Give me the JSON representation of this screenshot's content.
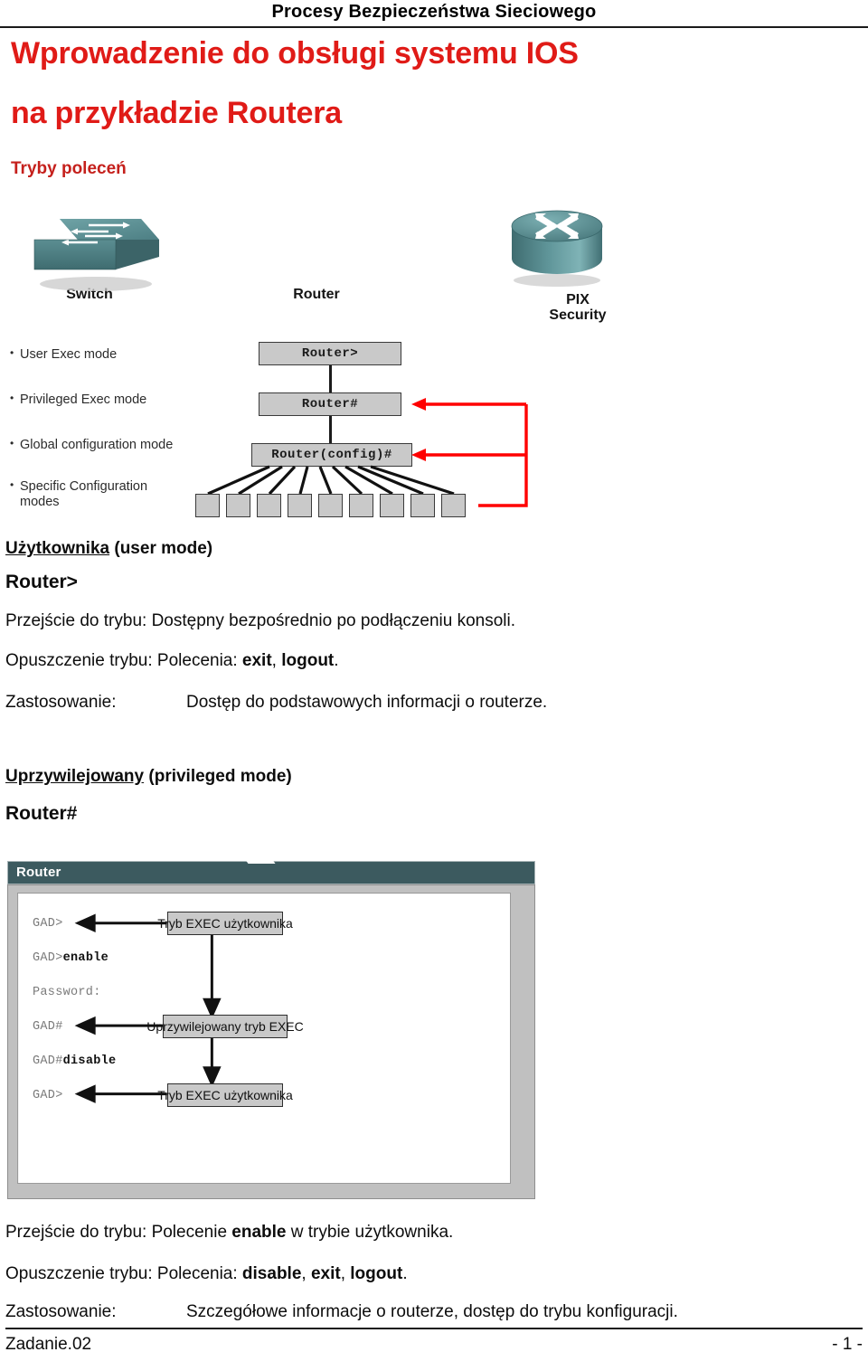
{
  "page": {
    "running_header": "Procesy Bezpieczeństwa Sieciowego",
    "title_line1": "Wprowadzenie do obsługi systemu IOS",
    "title_line2": "na przykładzie Routera",
    "subtitle": "Tryby poleceń",
    "title_color": "#e01b17",
    "subtitle_color": "#c5201c"
  },
  "figure_devices": {
    "switch": {
      "icon": "switch-icon",
      "caption": "Switch",
      "color": "#4f8489"
    },
    "router": {
      "icon": "router-icon",
      "caption": "Router",
      "color": "#4f8489"
    },
    "pix": {
      "icon": "firewall-icon",
      "caption_line1": "PIX",
      "caption_line2": "Security",
      "color": "#8e2f2f"
    }
  },
  "figure_hierarchy": {
    "bullets": [
      "User Exec mode",
      "Privileged Exec mode",
      "Global configuration mode",
      "Specific Configuration\nmodes"
    ],
    "bullet_1": "User Exec mode",
    "bullet_2": "Privileged Exec mode",
    "bullet_3": "Global configuration mode",
    "bullet_4a": "Specific Configuration",
    "bullet_4b": "modes",
    "nodes": [
      {
        "label": "Router>"
      },
      {
        "label": "Router#"
      },
      {
        "label": "Router(config)#"
      }
    ],
    "node_user": "Router>",
    "node_privileged": "Router#",
    "node_config": "Router(config)#",
    "leaf_count": 9,
    "return_arrow_color": "#ff0000"
  },
  "section_user": {
    "heading_underlined": "Użytkownika",
    "heading_rest": " (user mode)",
    "prompt": "Router>",
    "enter_label": "Przejście do trybu:",
    "enter_value": "Dostępny bezpośrednio po podłączeniu konsoli.",
    "leave_label": "Opuszczenie trybu: Polecenia:",
    "leave_cmd_1": "exit",
    "leave_cmd_sep": ", ",
    "leave_cmd_2": "logout",
    "leave_cmd_end": ".",
    "usage_label": "Zastosowanie:",
    "usage_value": "Dostęp do podstawowych informacji o routerze."
  },
  "section_privileged": {
    "heading_underlined": "Uprzywilejowany",
    "heading_rest": " (privileged mode)",
    "prompt": "Router#",
    "enter_label": "Przejście do trybu: Polecenie",
    "enter_cmd": "enable",
    "enter_rest": "w trybie użytkownika.",
    "leave_label": "Opuszczenie trybu: Polecenia:",
    "leave_cmd_1": "disable",
    "leave_cmd_2": "exit",
    "leave_cmd_3": "logout",
    "leave_cmd_end": ".",
    "usage_label": "Zastosowanie:",
    "usage_value": "Szczegółowe informacje o routerze, dostęp do trybu konfiguracji."
  },
  "router_window": {
    "title": "Router",
    "titlebar_color": "#3c5a5f",
    "terminal": [
      {
        "prompt": "GAD>",
        "command": ""
      },
      {
        "prompt": "GAD>",
        "command": "enable"
      },
      {
        "prompt": "Password:",
        "command": ""
      },
      {
        "prompt": "GAD#",
        "command": ""
      },
      {
        "prompt": "GAD#",
        "command": "disable"
      },
      {
        "prompt": "GAD>",
        "command": ""
      }
    ],
    "line1_prompt": "GAD>",
    "line2_prompt": "GAD>",
    "line2_cmd": "enable",
    "line3_prompt": "Password:",
    "line4_prompt": "GAD#",
    "line5_prompt": "GAD#",
    "line5_cmd": "disable",
    "line6_prompt": "GAD>",
    "flow_box_1": "Tryb EXEC użytkownika",
    "flow_box_2": "Uprzywilejowany tryb EXEC",
    "flow_box_3": "Tryb EXEC użytkownika"
  },
  "footer": {
    "left": "Zadanie.02",
    "right": "- 1 -"
  }
}
